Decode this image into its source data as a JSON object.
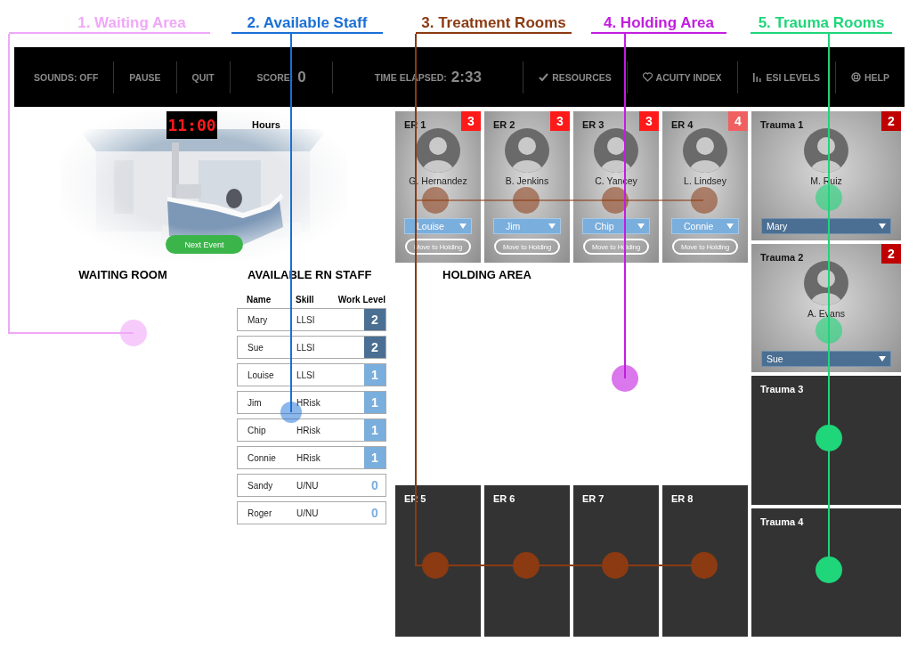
{
  "annotations": [
    {
      "label": "1. Waiting Area",
      "color": "#f0a8f8"
    },
    {
      "label": "2. Available Staff",
      "color": "#1a6fd6"
    },
    {
      "label": "3. Treatment Rooms",
      "color": "#8b3a12"
    },
    {
      "label": "4. Holding Area",
      "color": "#c21de0"
    },
    {
      "label": "5. Trauma Rooms",
      "color": "#1fd67a"
    }
  ],
  "toolbar": {
    "items": [
      {
        "kind": "button",
        "label": "SOUNDS: OFF"
      },
      {
        "kind": "button",
        "label": "PAUSE"
      },
      {
        "kind": "button",
        "label": "QUIT"
      },
      {
        "kind": "readout",
        "label": "SCORE:",
        "value": "0"
      },
      {
        "kind": "readout",
        "label": "TIME ELAPSED:",
        "value": "2:33"
      },
      {
        "kind": "icon_button",
        "label": "RESOURCES"
      },
      {
        "kind": "icon_button",
        "label": "ACUITY INDEX"
      },
      {
        "kind": "icon_button",
        "label": "ESI LEVELS"
      },
      {
        "kind": "icon_button",
        "label": "HELP"
      }
    ]
  },
  "waiting_room": {
    "clock": "11:00",
    "clock_unit": "Hours",
    "button": "Next Event",
    "title": "WAITING ROOM"
  },
  "staff": {
    "title": "AVAILABLE RN STAFF",
    "columns": [
      "Name",
      "Skill",
      "Work Level"
    ],
    "rows": [
      {
        "name": "Mary",
        "skill": "LLSI",
        "work_level": "2",
        "kind": "high"
      },
      {
        "name": "Sue",
        "skill": "LLSI",
        "work_level": "2",
        "kind": "high"
      },
      {
        "name": "Louise",
        "skill": "LLSI",
        "work_level": "1",
        "kind": "low"
      },
      {
        "name": "Jim",
        "skill": "HRisk",
        "work_level": "1",
        "kind": "low"
      },
      {
        "name": "Chip",
        "skill": "HRisk",
        "work_level": "1",
        "kind": "low"
      },
      {
        "name": "Connie",
        "skill": "HRisk",
        "work_level": "1",
        "kind": "low"
      },
      {
        "name": "Sandy",
        "skill": "U/NU",
        "work_level": "0",
        "kind": "none"
      },
      {
        "name": "Roger",
        "skill": "U/NU",
        "work_level": "0",
        "kind": "none"
      }
    ]
  },
  "holding_area": {
    "title": "HOLDING AREA"
  },
  "er_rooms": [
    {
      "kind": "occupied",
      "name": "ER 1",
      "patient": "G. Hernandez",
      "acuity": "3",
      "color": "#ff1a1a",
      "nurse": "Louise",
      "action": "Move to Holding"
    },
    {
      "kind": "occupied",
      "name": "ER 2",
      "patient": "B. Jenkins",
      "acuity": "3",
      "color": "#ff1a1a",
      "nurse": "Jim",
      "action": "Move to Holding"
    },
    {
      "kind": "occupied",
      "name": "ER 3",
      "patient": "C. Yancey",
      "acuity": "3",
      "color": "#ff1a1a",
      "nurse": "Chip",
      "action": "Move to Holding"
    },
    {
      "kind": "occupied",
      "name": "ER 4",
      "patient": "L. Lindsey",
      "acuity": "4",
      "color": "#f06060",
      "nurse": "Connie",
      "action": "Move to Holding"
    },
    {
      "kind": "empty",
      "name": "ER 5"
    },
    {
      "kind": "empty",
      "name": "ER 6"
    },
    {
      "kind": "empty",
      "name": "ER 7"
    },
    {
      "kind": "empty",
      "name": "ER 8"
    }
  ],
  "trauma_rooms": [
    {
      "kind": "occupied",
      "name": "Trauma 1",
      "patient": "M. Ruiz",
      "acuity": "2",
      "color": "#c00000",
      "nurse": "Mary"
    },
    {
      "kind": "occupied",
      "name": "Trauma 2",
      "patient": "A. Evans",
      "acuity": "2",
      "color": "#c00000",
      "nurse": "Sue"
    },
    {
      "kind": "empty",
      "name": "Trauma 3"
    },
    {
      "kind": "empty",
      "name": "Trauma 4"
    }
  ]
}
